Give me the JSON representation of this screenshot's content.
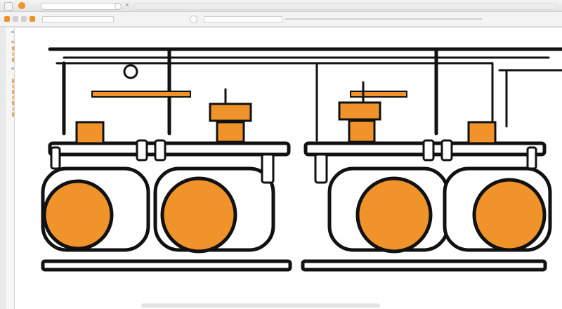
{
  "window": {
    "accent": "#f0932b"
  },
  "titlebar": {
    "icons": [
      "app-icon",
      "orange-circle-icon",
      "search-icon",
      "close-icon"
    ],
    "close_glyph": "×"
  },
  "toolbar": {
    "icons": [
      "tool-icon",
      "tool-icon",
      "tool-icon",
      "tool-icon",
      "tool-icon",
      "tool-icon"
    ]
  },
  "sidebar": {
    "sections": 3
  },
  "diagram": {
    "primary_color": "#f0932b",
    "line_color": "#111111",
    "units": 4
  }
}
